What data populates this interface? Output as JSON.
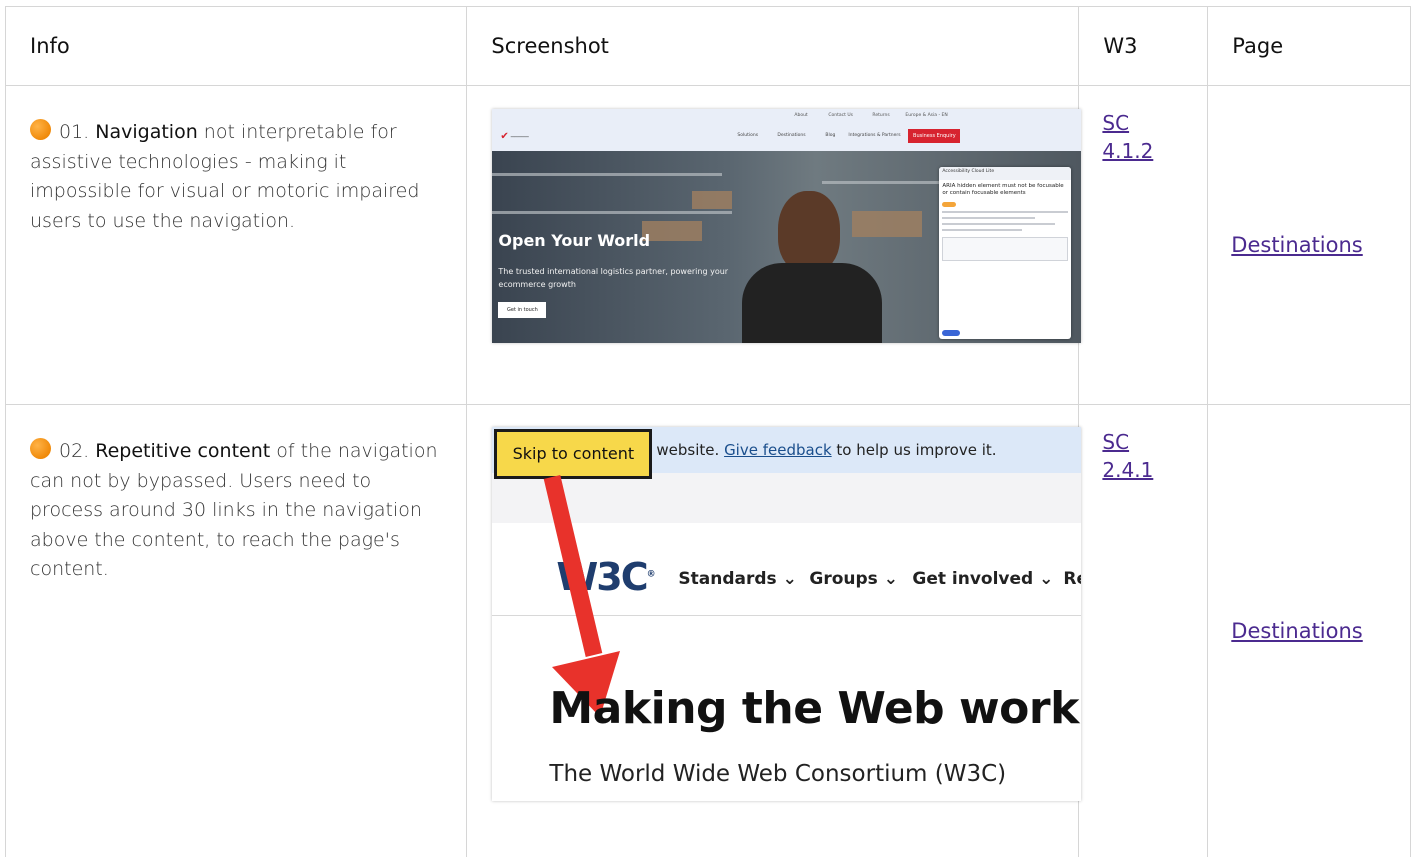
{
  "headers": {
    "info": "Info",
    "screenshot": "Screenshot",
    "w3": "W3",
    "page": "Page"
  },
  "rows": [
    {
      "number": "01.",
      "keyword": "Navigation",
      "description": "not interpretable for assistive technologies - making it impossible for visual or motoric impaired users to use the navigation.",
      "severity_color": "#f08a0a",
      "sc_prefix": "SC",
      "sc_number": "4.1.2",
      "page_link": "Destinations",
      "screenshot": {
        "util_links": [
          "About",
          "Contact Us",
          "Returns",
          "Europe & Asia - EN"
        ],
        "nav_links": [
          "Solutions",
          "Destinations",
          "Blog",
          "Integrations & Partners"
        ],
        "cta": "Business Enquiry",
        "hero_title": "Open Your World",
        "hero_sub": "The trusted international logistics partner, powering your ecommerce growth",
        "hero_button": "Get in touch",
        "panel_title": "Accessibility Cloud Lite",
        "panel_message": "ARIA hidden element must not be focusable or contain focusable elements"
      }
    },
    {
      "number": "02.",
      "keyword": "Repetitive content",
      "description": "of the navigation can not by bypassed. Users need to process around 30 links in the navigation above the content, to reach the page's content.",
      "severity_color": "#f08a0a",
      "sc_prefix": "SC",
      "sc_number": "2.4.1",
      "page_link": "Destinations",
      "screenshot": {
        "skip_link": "Skip to content",
        "banner_pre": "website.",
        "banner_link": "Give feedback",
        "banner_post": "to help us improve it.",
        "logo": "W3C",
        "nav": [
          "Standards ⌄",
          "Groups ⌄",
          "Get involved ⌄",
          "Re"
        ],
        "heading": "Making the Web work",
        "subheading": "The World Wide Web Consortium (W3C)"
      }
    }
  ]
}
